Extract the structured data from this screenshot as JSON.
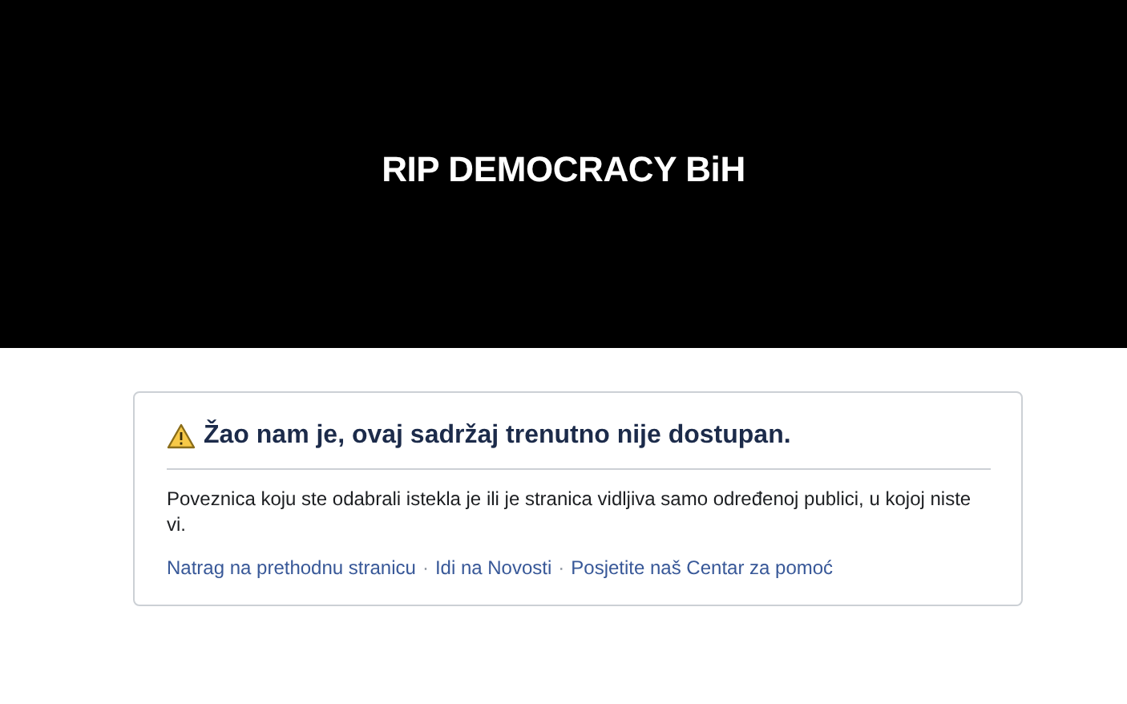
{
  "banner": {
    "title": "RIP DEMOCRACY BiH"
  },
  "notice": {
    "heading": "Žao nam je, ovaj sadržaj trenutno nije dostupan.",
    "message": "Poveznica koju ste odabrali istekla je ili je stranica vidljiva samo određenoj publici, u kojoj niste vi.",
    "links": [
      {
        "kind": "link",
        "text": "Natrag na prethodnu stranicu"
      },
      {
        "kind": "separator",
        "text": "·"
      },
      {
        "kind": "link",
        "text": "Idi na Novosti"
      },
      {
        "kind": "separator",
        "text": "·"
      },
      {
        "kind": "link",
        "text": "Posjetite naš Centar za pomoć"
      }
    ]
  }
}
